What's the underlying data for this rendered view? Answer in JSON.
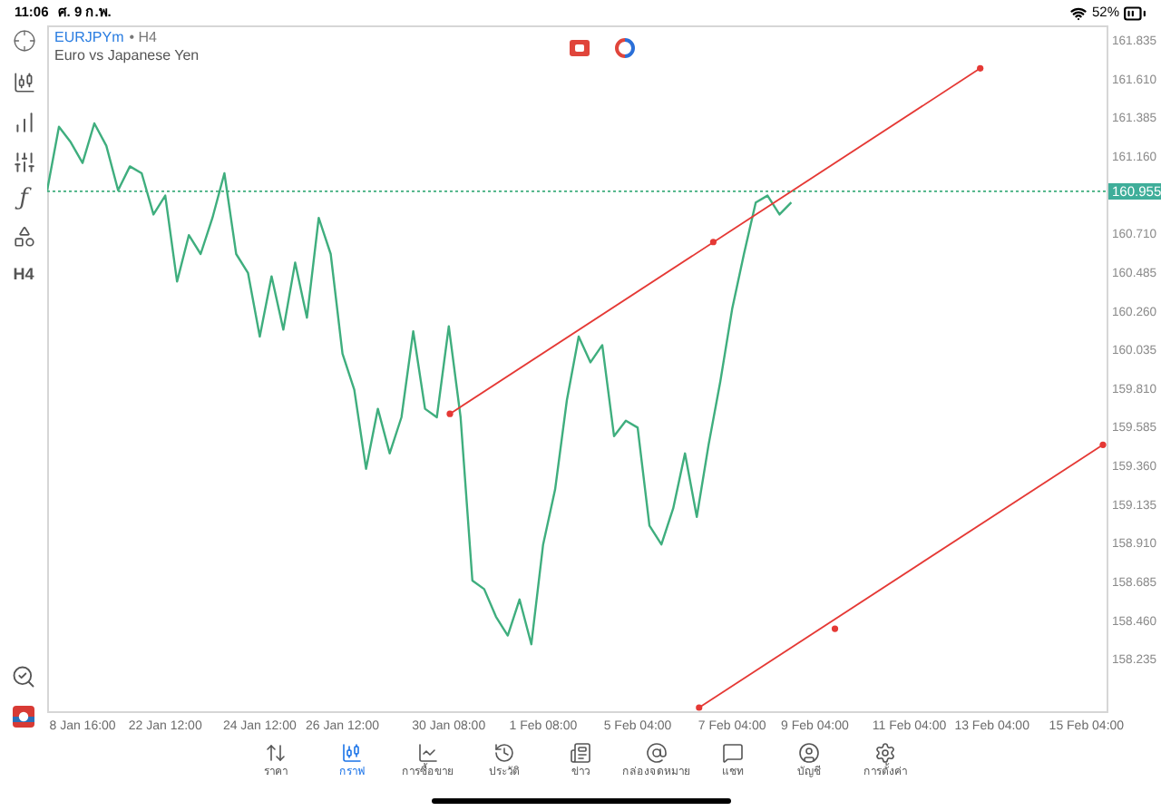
{
  "status_bar": {
    "time": "11:06",
    "date": "ศ. 9 ก.พ.",
    "battery": "52%"
  },
  "toolbar": {
    "function_glyph": "ƒ",
    "timeframe": "H4"
  },
  "chart": {
    "symbol": "EURJPYm",
    "period_label": "• H4",
    "description": "Euro vs Japanese Yen",
    "current_price": "160.955",
    "chart_data": {
      "type": "line",
      "ylim": [
        157.93,
        161.92
      ],
      "categories": [
        null,
        null,
        null,
        "8 Jan 16:00",
        null,
        null,
        null,
        null,
        null,
        null,
        "22 Jan 12:00",
        null,
        null,
        null,
        null,
        null,
        null,
        null,
        "24 Jan 12:00",
        null,
        null,
        null,
        null,
        null,
        null,
        "26 Jan 12:00",
        null,
        null,
        null,
        null,
        null,
        null,
        null,
        null,
        "30 Jan 08:00",
        null,
        null,
        null,
        null,
        null,
        null,
        null,
        "1 Feb 08:00",
        null,
        null,
        null,
        null,
        null,
        null,
        null,
        "5 Feb 04:00",
        null,
        null,
        null,
        null,
        null,
        null,
        null,
        "7 Feb 04:00",
        null,
        null,
        null,
        null,
        null,
        null,
        "9 Feb 04:00",
        null,
        null,
        null,
        null,
        null,
        null,
        null,
        "11 Feb 04:00",
        null,
        null,
        null,
        null,
        null,
        null,
        "13 Feb 04:00",
        null,
        null,
        null,
        null,
        null,
        null,
        null,
        "15 Feb 04:00",
        null
      ],
      "series": [
        {
          "color": "#3fae7e",
          "values": [
            160.96,
            161.33,
            161.24,
            161.12,
            161.35,
            161.22,
            160.96,
            161.1,
            161.06,
            160.82,
            160.93,
            160.43,
            160.7,
            160.59,
            160.8,
            161.06,
            160.59,
            160.48,
            160.11,
            160.46,
            160.15,
            160.54,
            160.22,
            160.8,
            160.59,
            160.01,
            159.8,
            159.34,
            159.69,
            159.43,
            159.64,
            160.14,
            159.69,
            159.64,
            160.17,
            159.64,
            158.69,
            158.64,
            158.48,
            158.37,
            158.58,
            158.32,
            158.9,
            159.22,
            159.74,
            160.11,
            159.96,
            160.06,
            159.53,
            159.62,
            159.58,
            159.01,
            158.9,
            159.11,
            159.43,
            159.06,
            159.48,
            159.85,
            160.27,
            160.59,
            160.89,
            160.93,
            160.82,
            160.89,
            null,
            null,
            null,
            null,
            null,
            null,
            null,
            null,
            null,
            null,
            null,
            null,
            null,
            null,
            null,
            null,
            null,
            null,
            null,
            null,
            null,
            null,
            null,
            null,
            null,
            null
          ]
        }
      ],
      "yticks": [
        {
          "value": 161.835,
          "label": "161.835"
        },
        {
          "value": 161.61,
          "label": "161.610"
        },
        {
          "value": 161.385,
          "label": "161.385"
        },
        {
          "value": 161.16,
          "label": "161.160"
        },
        {
          "value": 160.71,
          "label": "160.710"
        },
        {
          "value": 160.485,
          "label": "160.485"
        },
        {
          "value": 160.26,
          "label": "160.260"
        },
        {
          "value": 160.035,
          "label": "160.035"
        },
        {
          "value": 159.81,
          "label": "159.810"
        },
        {
          "value": 159.585,
          "label": "159.585"
        },
        {
          "value": 159.36,
          "label": "159.360"
        },
        {
          "value": 159.135,
          "label": "159.135"
        },
        {
          "value": 158.91,
          "label": "158.910"
        },
        {
          "value": 158.685,
          "label": "158.685"
        },
        {
          "value": 158.46,
          "label": "158.460"
        },
        {
          "value": 158.235,
          "label": "158.235"
        }
      ]
    },
    "drawings": [
      {
        "kind": "trendline"
      },
      {
        "kind": "trendline"
      },
      {
        "kind": "price_line"
      }
    ]
  },
  "tabs": [
    {
      "label": "ราคา",
      "kind": "quotes",
      "selected": false
    },
    {
      "label": "กราฟ",
      "kind": "chart",
      "selected": true
    },
    {
      "label": "การซื้อขาย",
      "kind": "trade",
      "selected": false
    },
    {
      "label": "ประวัติ",
      "kind": "history",
      "selected": false
    },
    {
      "label": "ข่าว",
      "kind": "news",
      "selected": false
    },
    {
      "label": "กล่องจดหมาย",
      "kind": "mail",
      "selected": false
    },
    {
      "label": "แชท",
      "kind": "chat",
      "selected": false
    },
    {
      "label": "บัญชี",
      "kind": "account",
      "selected": false
    },
    {
      "label": "การตั้งค่า",
      "kind": "settings",
      "selected": false
    }
  ]
}
